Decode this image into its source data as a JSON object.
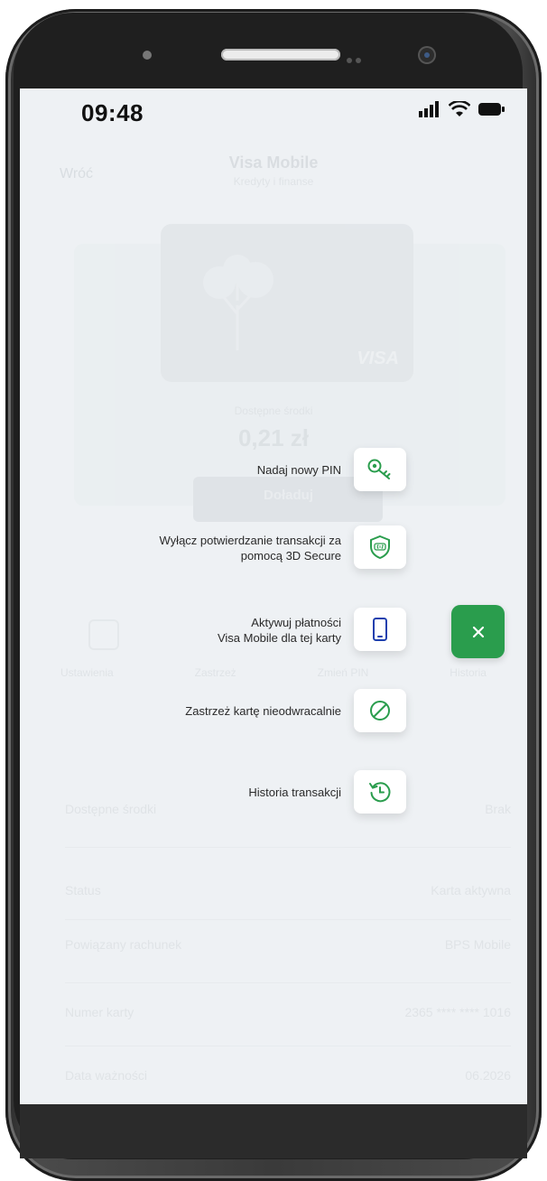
{
  "status_bar": {
    "time": "09:48"
  },
  "background": {
    "back_label": "Wróć",
    "title": "Visa Mobile",
    "subtitle": "Kredyty i finanse",
    "card_brand": "VISA",
    "balance_label": "Dostępne środki",
    "balance": "0,21 zł",
    "pay_button": "Doładuj",
    "tabs": [
      "Ustawienia",
      "Zastrzeż",
      "Zmień PIN",
      "Historia"
    ],
    "rows": [
      {
        "label": "Dostępne środki",
        "value": "Brak"
      },
      {
        "label": "Status",
        "value": "Karta aktywna"
      },
      {
        "label": "Powiązany rachunek",
        "value": "BPS Mobile"
      },
      {
        "label": "Numer karty",
        "value": "2365 **** **** 1016"
      },
      {
        "label": "Data ważności",
        "value": "06.2026"
      }
    ]
  },
  "menu": {
    "items": [
      {
        "label_line1": "Nadaj nowy PIN",
        "label_line2": "",
        "icon": "key-icon"
      },
      {
        "label_line1": "Wyłącz potwierdzanie transakcji za",
        "label_line2": "pomocą 3D Secure",
        "icon": "shield-3ds-icon"
      },
      {
        "label_line1": "Aktywuj płatności",
        "label_line2": "Visa Mobile dla tej karty",
        "icon": "phone-icon"
      },
      {
        "label_line1": "Zastrzeż kartę nieodwracalnie",
        "label_line2": "",
        "icon": "block-icon"
      },
      {
        "label_line1": "Historia transakcji",
        "label_line2": "",
        "icon": "history-icon"
      }
    ],
    "close_icon": "close-icon"
  },
  "colors": {
    "accent": "#2a9d4d",
    "overlay": "#eef1f4"
  }
}
